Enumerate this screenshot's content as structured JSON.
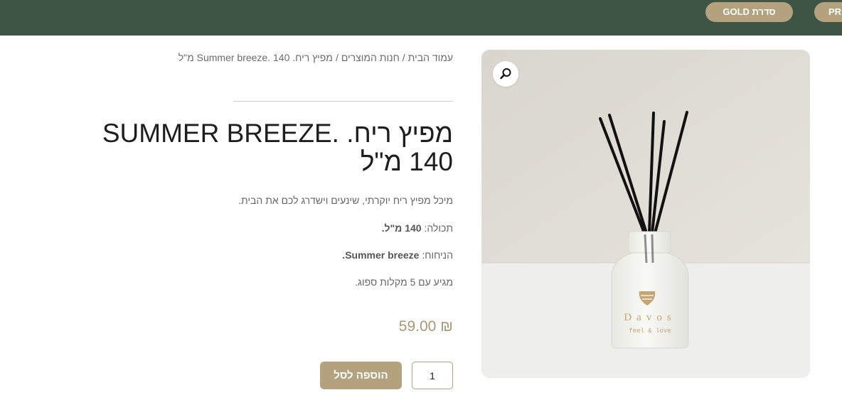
{
  "header": {
    "nav_gold_label": "סדרת GOLD",
    "nav_pr_label": "PR"
  },
  "breadcrumb": {
    "home": "עמוד הבית",
    "shop": "חנות המוצרים",
    "current": "מפיץ ריח. Summer breeze. 140 מ\"ל"
  },
  "product": {
    "title": "מפיץ ריח. SUMMER BREEZE. 140 מ\"ל",
    "description": "מיכל מפיץ ריח יוקרתי, שינעים וישדרג לכם את הבית.",
    "capacity_label": "תכולה:",
    "capacity_value": "140 מ\"ל.",
    "scent_label": "הניחוח:",
    "scent_value": "Summer breeze.",
    "sticks_note": "מגיע עם 5 מקלות ספוג.",
    "price": "₪ 59.00",
    "quantity": "1",
    "add_to_cart_label": "הוספה לסל",
    "bottle_brand": "Davos",
    "bottle_tagline": "feel & love"
  },
  "colors": {
    "header_bg": "#3e5444",
    "accent": "#b3a27d",
    "price": "#a89874"
  },
  "icons": {
    "zoom": "magnifier-icon"
  }
}
